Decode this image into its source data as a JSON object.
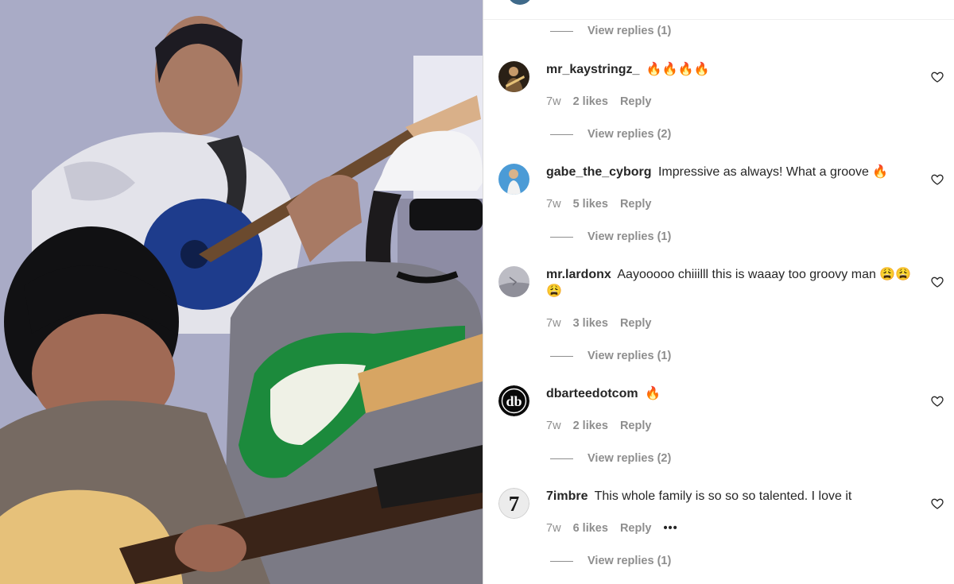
{
  "top": {
    "view_replies": "View replies (1)"
  },
  "comments": [
    {
      "username": "mr_kaystringz_",
      "text": "🔥🔥🔥🔥",
      "time": "7w",
      "likes": "2 likes",
      "reply": "Reply",
      "view_replies": "View replies (2)",
      "avatar": "guitarist-avatar"
    },
    {
      "username": "gabe_the_cyborg",
      "text": "Impressive as always! What a groove 🔥",
      "time": "7w",
      "likes": "5 likes",
      "reply": "Reply",
      "view_replies": "View replies (1)",
      "avatar": "figure-on-blue-avatar"
    },
    {
      "username": "mr.lardonx",
      "text": "Aayooooo chiiilll this is waaay too groovy man 😩😩😩",
      "time": "7w",
      "likes": "3 likes",
      "reply": "Reply",
      "view_replies": "View replies (1)",
      "avatar": "grey-photo-avatar"
    },
    {
      "username": "dbarteedotcom",
      "text": "🔥",
      "time": "7w",
      "likes": "2 likes",
      "reply": "Reply",
      "view_replies": "View replies (2)",
      "avatar": "db-logo-avatar"
    },
    {
      "username": "7imbre",
      "text": "This whole family is so so so talented. I love it",
      "time": "7w",
      "likes": "6 likes",
      "reply": "Reply",
      "more": "•••",
      "view_replies": "View replies (1)",
      "avatar": "seven-logo-avatar"
    }
  ],
  "colors": {
    "meta_grey": "#8e8e8e",
    "text": "#262626",
    "separator": "#efefef"
  }
}
